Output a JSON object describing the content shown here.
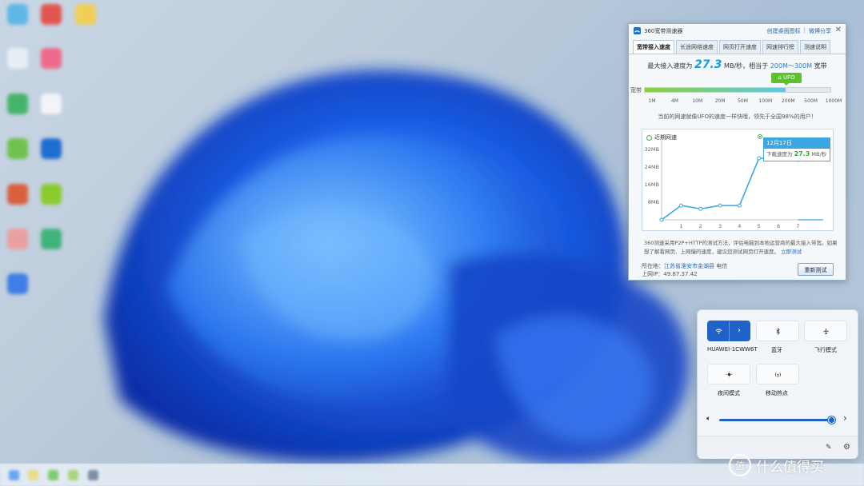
{
  "speed_window": {
    "title": "360宽带测速器",
    "links": [
      "创建桌面图标",
      "微博分享"
    ],
    "tabs": [
      "宽带接入速度",
      "长途网络速度",
      "网页打开速度",
      "网速排行榜",
      "测速说明"
    ],
    "speed_prefix": "最大接入速度为",
    "speed_value": "27.3",
    "speed_unit": "MB/秒，相当于",
    "bandwidth_range": "200M～300M",
    "bandwidth_suffix": "宽带",
    "ufo_badge": "UFO",
    "bandwidth_label": "宽带",
    "bandwidth_fill_fraction": 0.76,
    "scale": [
      "1M",
      "4M",
      "10M",
      "20M",
      "50M",
      "100M",
      "200M",
      "500M",
      "1000M"
    ],
    "compare_text": "当前的网速就像UFO的速度一样快哦，领先于全国98%的用户！",
    "chart_title": "近期网速",
    "tooltip_date": "12月17日",
    "tooltip_label": "下载速度为",
    "tooltip_value": "27.3",
    "tooltip_unit": "MB/秒",
    "info_text": "360测速采用P2P+HTTP的测试方法，评估电脑到本地运营商的最大接入带宽。如果想了解看网页、上网慢的速度，建议您测试网页打开速度。",
    "info_link": "立即测试",
    "location_label": "所在地：",
    "location_value": "江苏省淮安市金湖县",
    "isp": "电信",
    "ip_label": "上网IP：",
    "ip_value": "49.87.37.42",
    "retest_button": "重新测试",
    "colors": {
      "accent": "#1a9be0",
      "ufo": "#5cc12c",
      "line": "#3ba6e2"
    }
  },
  "chart_data": {
    "type": "line",
    "x": [
      0,
      1,
      2,
      3,
      4,
      5,
      6,
      7
    ],
    "series": [
      {
        "values": [
          0,
          6.5,
          5,
          6.5,
          6.5,
          28,
          28,
          27.3
        ]
      }
    ],
    "y_ticks": [
      "8MB",
      "16MB",
      "24MB",
      "32MB"
    ],
    "x_ticks": [
      "1",
      "2",
      "3",
      "4",
      "5",
      "6",
      "7"
    ],
    "ylim": [
      0,
      36
    ],
    "grid": false
  },
  "quick_settings": {
    "tiles": [
      {
        "label": "HUAWEI-1CWW6T",
        "icon": "wifi-icon",
        "active": true
      },
      {
        "label": "蓝牙",
        "icon": "bluetooth-icon",
        "active": false
      },
      {
        "label": "飞行模式",
        "icon": "airplane-icon",
        "active": false
      },
      {
        "label": "夜间模式",
        "icon": "brightness-icon",
        "active": false
      },
      {
        "label": "移动热点",
        "icon": "hotspot-icon",
        "active": false
      }
    ],
    "volume_fraction": 0.95
  },
  "watermark": {
    "text": "什么值得买",
    "logo": "值"
  }
}
